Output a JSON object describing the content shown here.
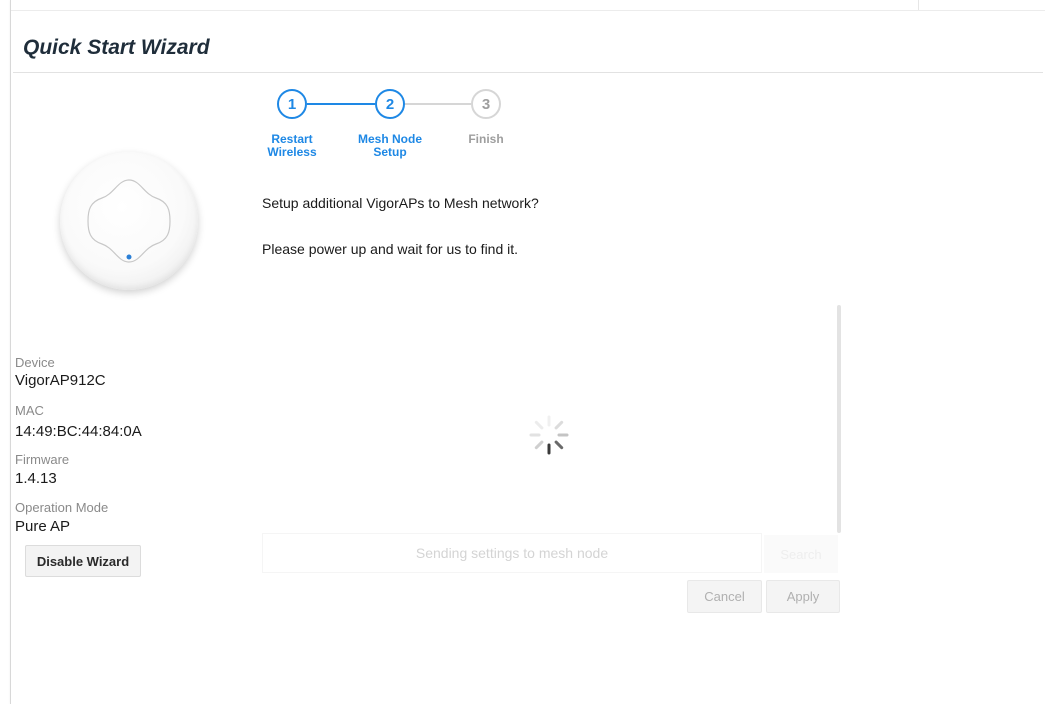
{
  "wizard": {
    "title": "Quick Start Wizard"
  },
  "steps": [
    {
      "number": "1",
      "label_line1": "Restart",
      "label_line2": "Wireless",
      "state": "active"
    },
    {
      "number": "2",
      "label_line1": "Mesh Node",
      "label_line2": "Setup",
      "state": "active"
    },
    {
      "number": "3",
      "label_line1": "Finish",
      "label_line2": "",
      "state": "inactive"
    }
  ],
  "device_info": {
    "device_label": "Device",
    "device_value": "VigorAP912C",
    "mac_label": "MAC",
    "mac_value": "14:49:BC:44:84:0A",
    "firmware_label": "Firmware",
    "firmware_value": "1.4.13",
    "mode_label": "Operation Mode",
    "mode_value": "Pure AP"
  },
  "buttons": {
    "disable_wizard": "Disable Wizard",
    "search": "Search",
    "cancel": "Cancel",
    "apply": "Apply"
  },
  "main": {
    "question": "Setup additional VigorAPs to Mesh network?",
    "instruction": "Please power up and wait for us to find it.",
    "status": "Sending settings to mesh node"
  },
  "colors": {
    "accent": "#1e88e5",
    "inactive": "#d6d6d6",
    "title": "#1f2d3a"
  }
}
